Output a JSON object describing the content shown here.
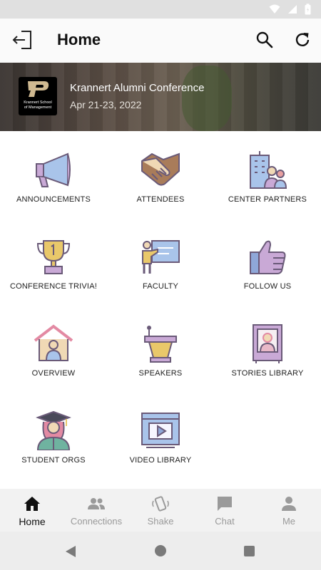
{
  "app_bar": {
    "title": "Home"
  },
  "banner": {
    "logo_text": "Krannert School of Management",
    "conference_title": "Krannert Alumni Conference",
    "conference_dates": "Apr 21-23, 2022"
  },
  "tiles": [
    {
      "label": "ANNOUNCEMENTS",
      "icon": "megaphone-icon"
    },
    {
      "label": "ATTENDEES",
      "icon": "handshake-icon"
    },
    {
      "label": "CENTER PARTNERS",
      "icon": "building-people-icon"
    },
    {
      "label": "CONFERENCE TRIVIA!",
      "icon": "trophy-icon"
    },
    {
      "label": "FACULTY",
      "icon": "teacher-board-icon"
    },
    {
      "label": "FOLLOW US",
      "icon": "thumbs-up-icon"
    },
    {
      "label": "OVERVIEW",
      "icon": "house-person-icon"
    },
    {
      "label": "SPEAKERS",
      "icon": "podium-icon"
    },
    {
      "label": "STORIES LIBRARY",
      "icon": "book-portrait-icon"
    },
    {
      "label": "STUDENT ORGS",
      "icon": "graduate-icon"
    },
    {
      "label": "VIDEO LIBRARY",
      "icon": "video-player-icon"
    }
  ],
  "bottom_nav": [
    {
      "label": "Home",
      "icon": "home-icon",
      "active": true
    },
    {
      "label": "Connections",
      "icon": "people-icon",
      "active": false
    },
    {
      "label": "Shake",
      "icon": "shake-phone-icon",
      "active": false
    },
    {
      "label": "Chat",
      "icon": "chat-icon",
      "active": false
    },
    {
      "label": "Me",
      "icon": "person-icon",
      "active": false
    }
  ],
  "colors": {
    "icon_outline": "#6a5a78",
    "icon_purple": "#c9a9d6",
    "icon_blue": "#a9c4ea",
    "icon_gold": "#e9c86a",
    "active_nav": "#111111",
    "inactive_nav": "#9a9a9a"
  }
}
